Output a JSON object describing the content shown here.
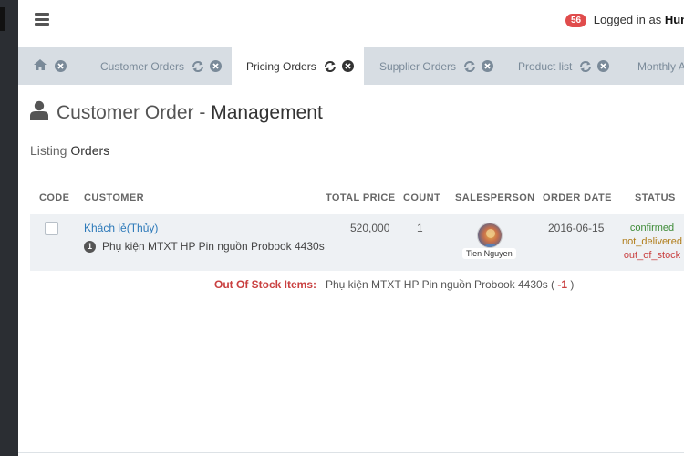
{
  "header": {
    "notification_count": "56",
    "logged_in_label": "Logged in as",
    "user_name": "Hung"
  },
  "tabs": [
    {
      "label": "",
      "icon": "home-icon"
    },
    {
      "label": "Customer Orders"
    },
    {
      "label": "Pricing Orders",
      "active": true
    },
    {
      "label": "Supplier Orders"
    },
    {
      "label": "Product list"
    },
    {
      "label": "Monthly A"
    }
  ],
  "page": {
    "title_prefix": "Customer Order - ",
    "title_strong": "Management",
    "listing_prefix": "Listing",
    "listing_strong": "Orders"
  },
  "table": {
    "columns": [
      "CODE",
      "CUSTOMER",
      "TOTAL PRICE",
      "COUNT",
      "SALESPERSON",
      "ORDER DATE",
      "STATUS"
    ],
    "rows": [
      {
        "customer": "Khách lẻ(Thủy)",
        "item_number": "1",
        "item_name": "Phụ kiện MTXT HP Pin nguồn Probook 4430s",
        "total_price": "520,000",
        "count": "1",
        "salesperson": "Tien Nguyen",
        "order_date": "2016-06-15",
        "status": [
          "confirmed",
          "not_delivered",
          "out_of_stock"
        ]
      }
    ]
  },
  "out_of_stock": {
    "label": "Out Of Stock Items:",
    "item": "Phụ kiện MTXT HP Pin nguồn Probook 4430s (",
    "qty": "-1",
    "close": ")"
  },
  "colors": {
    "confirmed": "#3d8b37",
    "not_delivered": "#b07d1a",
    "out_of_stock": "#c94040",
    "link": "#2c79b9"
  }
}
